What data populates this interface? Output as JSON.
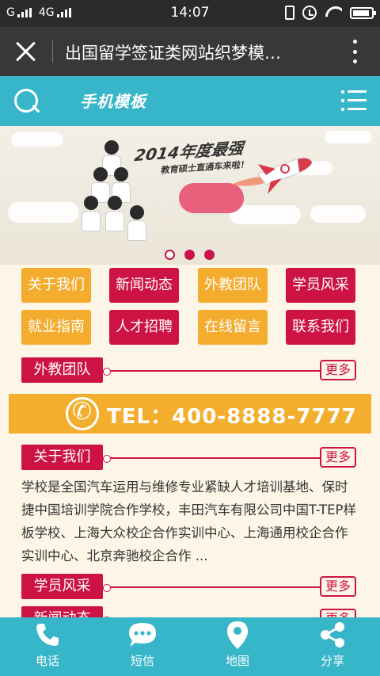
{
  "statusbar": {
    "carrier_left": "G",
    "carrier_right": "4G",
    "time": "14:07"
  },
  "titlebar": {
    "title": "出国留学签证类网站织梦模…"
  },
  "header": {
    "logo": "手机模板"
  },
  "banner": {
    "headline": "2014年度最强",
    "subline": "教育硕士直通车来啦！",
    "slides": 3,
    "active_slide": 2
  },
  "nav": [
    {
      "label": "关于我们",
      "color": "#f3ac2e"
    },
    {
      "label": "新闻动态",
      "color": "#cc1343"
    },
    {
      "label": "外教团队",
      "color": "#f3ac2e"
    },
    {
      "label": "学员风采",
      "color": "#cc1343"
    },
    {
      "label": "就业指南",
      "color": "#f3ac2e"
    },
    {
      "label": "人才招聘",
      "color": "#cc1343"
    },
    {
      "label": "在线留言",
      "color": "#f3ac2e"
    },
    {
      "label": "联系我们",
      "color": "#cc1343"
    }
  ],
  "sections": {
    "teachers": {
      "title": "外教团队",
      "more": "更多"
    },
    "about": {
      "title": "关于我们",
      "more": "更多"
    },
    "students": {
      "title": "学员风采",
      "more": "更多"
    },
    "news": {
      "title": "新闻动态",
      "more": "更多"
    }
  },
  "phone": {
    "text": "TEL：400-8888-7777"
  },
  "about_text": "学校是全国汽车运用与维修专业紧缺人才培训基地、保时捷中国培训学院合作学校，丰田汽车有限公司中国T-TEP样板学校、上海大众校企合作实训中心、上海通用校企合作实训中心、北京奔驰校企合作 ...",
  "bottom_nav": [
    {
      "label": "电话",
      "icon": "phone-icon"
    },
    {
      "label": "短信",
      "icon": "chat-icon"
    },
    {
      "label": "地图",
      "icon": "map-pin-icon"
    },
    {
      "label": "分享",
      "icon": "share-icon"
    }
  ],
  "colors": {
    "teal": "#36b6c8",
    "orange": "#f3ac2e",
    "crimson": "#cc1343",
    "background": "#fdf6e6"
  }
}
